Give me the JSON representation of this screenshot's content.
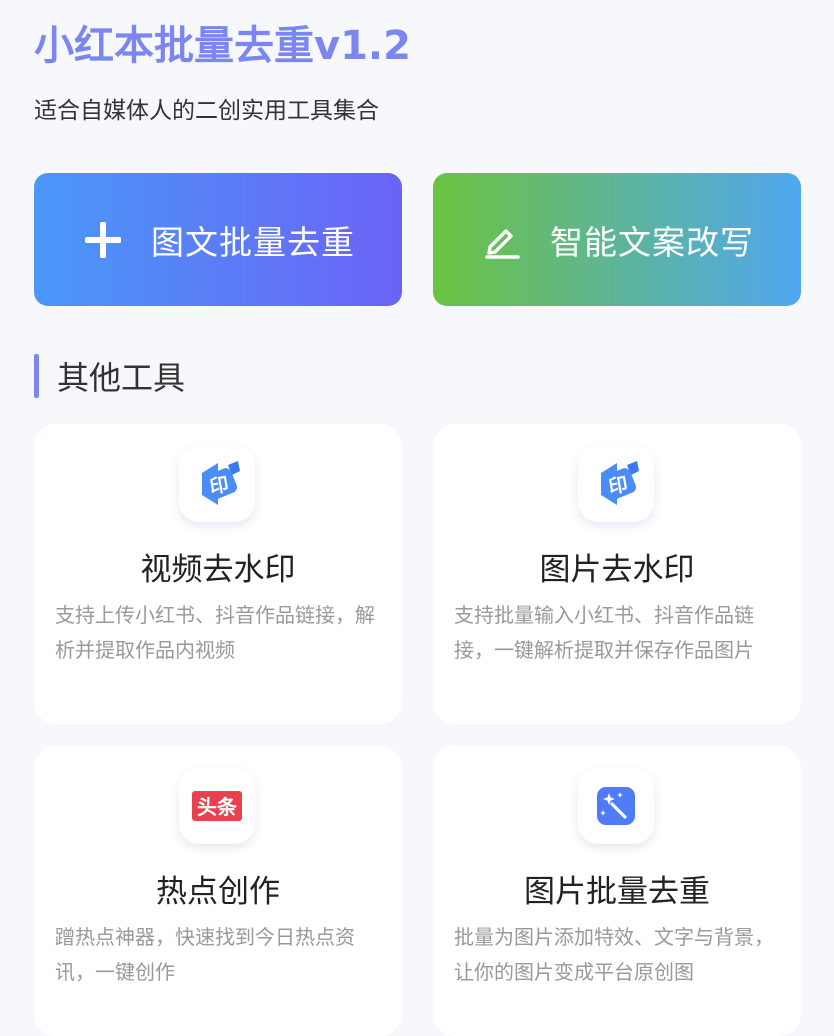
{
  "header": {
    "title": "小红本批量去重v1.2",
    "subtitle": "适合自媒体人的二创实用工具集合"
  },
  "actions": {
    "batch_dedupe_label": "图文批量去重",
    "rewrite_label": "智能文案改写"
  },
  "section": {
    "title": "其他工具"
  },
  "tools": [
    {
      "title": "视频去水印",
      "description": "支持上传小红书、抖音作品链接，解析并提取作品内视频",
      "icon": "watermark-icon"
    },
    {
      "title": "图片去水印",
      "description": "支持批量输入小红书、抖音作品链接，一键解析提取并保存作品图片",
      "icon": "watermark-icon"
    },
    {
      "title": "热点创作",
      "description": "蹭热点神器，快速找到今日热点资讯，一键创作",
      "icon": "toutiao-icon",
      "icon_text": "头条"
    },
    {
      "title": "图片批量去重",
      "description": "批量为图片添加特效、文字与背景，让你的图片变成平台原创图",
      "icon": "magic-wand-icon"
    }
  ],
  "colors": {
    "accent": "#7c86f0",
    "background": "#f7f8fc",
    "dedupe_gradient": [
      "#4a98f8",
      "#6b63f6"
    ],
    "rewrite_gradient": [
      "#6cc240",
      "#4fa8f0"
    ],
    "description_text": "#999999",
    "toutiao_red": "#e8404e"
  }
}
